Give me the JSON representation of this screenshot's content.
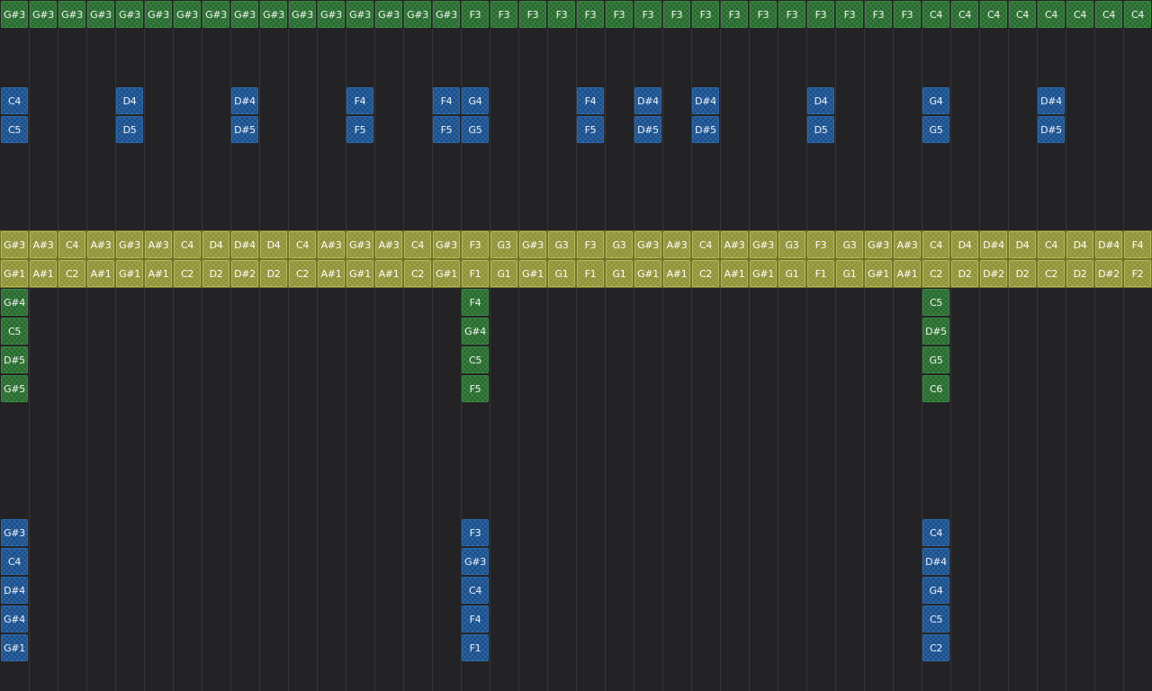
{
  "colors": {
    "background": "#232325",
    "column_line": "#37373b",
    "green_note": "#256b2c",
    "blue_note": "#174f8e",
    "yellow_note": "#8f9233",
    "yellow_band": "#72742a"
  },
  "columns": 40,
  "rows": [
    {
      "kind": "green",
      "row": 0,
      "notes": [
        "G#3",
        "G#3",
        "G#3",
        "G#3",
        "G#3",
        "G#3",
        "G#3",
        "G#3",
        "G#3",
        "G#3",
        "G#3",
        "G#3",
        "G#3",
        "G#3",
        "G#3",
        "G#3",
        "F3",
        "F3",
        "F3",
        "F3",
        "F3",
        "F3",
        "F3",
        "F3",
        "F3",
        "F3",
        "F3",
        "F3",
        "F3",
        "F3",
        "F3",
        "F3",
        "C4",
        "C4",
        "C4",
        "C4",
        "C4",
        "C4",
        "C4",
        "C4"
      ]
    },
    {
      "kind": "blue",
      "row": 3,
      "notes": [
        "C4",
        "",
        "",
        "",
        "D4",
        "",
        "",
        "",
        "D#4",
        "",
        "",
        "",
        "F4",
        "",
        "",
        "F4",
        "G4",
        "",
        "",
        "",
        "F4",
        "",
        "D#4",
        "",
        "D#4",
        "",
        "",
        "",
        "D4",
        "",
        "",
        "",
        "G4",
        "",
        "",
        "",
        "D#4",
        "",
        "",
        ""
      ]
    },
    {
      "kind": "blue",
      "row": 4,
      "notes": [
        "C5",
        "",
        "",
        "",
        "D5",
        "",
        "",
        "",
        "D#5",
        "",
        "",
        "",
        "F5",
        "",
        "",
        "F5",
        "G5",
        "",
        "",
        "",
        "F5",
        "",
        "D#5",
        "",
        "D#5",
        "",
        "",
        "",
        "D5",
        "",
        "",
        "",
        "G5",
        "",
        "",
        "",
        "D#5",
        "",
        "",
        ""
      ]
    },
    {
      "kind": "yellow",
      "row": 8,
      "notes": [
        "G#3",
        "A#3",
        "C4",
        "A#3",
        "G#3",
        "A#3",
        "C4",
        "D4",
        "D#4",
        "D4",
        "C4",
        "A#3",
        "G#3",
        "A#3",
        "C4",
        "G#3",
        "F3",
        "G3",
        "G#3",
        "G3",
        "F3",
        "G3",
        "G#3",
        "A#3",
        "C4",
        "A#3",
        "G#3",
        "G3",
        "F3",
        "G3",
        "G#3",
        "A#3",
        "C4",
        "D4",
        "D#4",
        "D4",
        "C4",
        "D4",
        "D#4",
        "F4"
      ]
    },
    {
      "kind": "yellow",
      "row": 9,
      "notes": [
        "G#1",
        "A#1",
        "C2",
        "A#1",
        "G#1",
        "A#1",
        "C2",
        "D2",
        "D#2",
        "D2",
        "C2",
        "A#1",
        "G#1",
        "A#1",
        "C2",
        "G#1",
        "F1",
        "G1",
        "G#1",
        "G1",
        "F1",
        "G1",
        "G#1",
        "A#1",
        "C2",
        "A#1",
        "G#1",
        "G1",
        "F1",
        "G1",
        "G#1",
        "A#1",
        "C2",
        "D2",
        "D#2",
        "D2",
        "C2",
        "D2",
        "D#2",
        "F2"
      ]
    },
    {
      "kind": "green",
      "row": 10,
      "notes": [
        "G#4",
        "",
        "",
        "",
        "",
        "",
        "",
        "",
        "",
        "",
        "",
        "",
        "",
        "",
        "",
        "",
        "F4",
        "",
        "",
        "",
        "",
        "",
        "",
        "",
        "",
        "",
        "",
        "",
        "",
        "",
        "",
        "",
        "C5",
        "",
        "",
        "",
        "",
        "",
        "",
        ""
      ]
    },
    {
      "kind": "green",
      "row": 11,
      "notes": [
        "C5",
        "",
        "",
        "",
        "",
        "",
        "",
        "",
        "",
        "",
        "",
        "",
        "",
        "",
        "",
        "",
        "G#4",
        "",
        "",
        "",
        "",
        "",
        "",
        "",
        "",
        "",
        "",
        "",
        "",
        "",
        "",
        "",
        "D#5",
        "",
        "",
        "",
        "",
        "",
        "",
        ""
      ]
    },
    {
      "kind": "green",
      "row": 12,
      "notes": [
        "D#5",
        "",
        "",
        "",
        "",
        "",
        "",
        "",
        "",
        "",
        "",
        "",
        "",
        "",
        "",
        "",
        "C5",
        "",
        "",
        "",
        "",
        "",
        "",
        "",
        "",
        "",
        "",
        "",
        "",
        "",
        "",
        "",
        "G5",
        "",
        "",
        "",
        "",
        "",
        "",
        ""
      ]
    },
    {
      "kind": "green",
      "row": 13,
      "notes": [
        "G#5",
        "",
        "",
        "",
        "",
        "",
        "",
        "",
        "",
        "",
        "",
        "",
        "",
        "",
        "",
        "",
        "F5",
        "",
        "",
        "",
        "",
        "",
        "",
        "",
        "",
        "",
        "",
        "",
        "",
        "",
        "",
        "",
        "C6",
        "",
        "",
        "",
        "",
        "",
        "",
        ""
      ]
    },
    {
      "kind": "blue",
      "row": 18,
      "notes": [
        "G#3",
        "",
        "",
        "",
        "",
        "",
        "",
        "",
        "",
        "",
        "",
        "",
        "",
        "",
        "",
        "",
        "F3",
        "",
        "",
        "",
        "",
        "",
        "",
        "",
        "",
        "",
        "",
        "",
        "",
        "",
        "",
        "",
        "C4",
        "",
        "",
        "",
        "",
        "",
        "",
        ""
      ]
    },
    {
      "kind": "blue",
      "row": 19,
      "notes": [
        "C4",
        "",
        "",
        "",
        "",
        "",
        "",
        "",
        "",
        "",
        "",
        "",
        "",
        "",
        "",
        "",
        "G#3",
        "",
        "",
        "",
        "",
        "",
        "",
        "",
        "",
        "",
        "",
        "",
        "",
        "",
        "",
        "",
        "D#4",
        "",
        "",
        "",
        "",
        "",
        "",
        ""
      ]
    },
    {
      "kind": "blue",
      "row": 20,
      "notes": [
        "D#4",
        "",
        "",
        "",
        "",
        "",
        "",
        "",
        "",
        "",
        "",
        "",
        "",
        "",
        "",
        "",
        "C4",
        "",
        "",
        "",
        "",
        "",
        "",
        "",
        "",
        "",
        "",
        "",
        "",
        "",
        "",
        "",
        "G4",
        "",
        "",
        "",
        "",
        "",
        "",
        ""
      ]
    },
    {
      "kind": "blue",
      "row": 21,
      "notes": [
        "G#4",
        "",
        "",
        "",
        "",
        "",
        "",
        "",
        "",
        "",
        "",
        "",
        "",
        "",
        "",
        "",
        "F4",
        "",
        "",
        "",
        "",
        "",
        "",
        "",
        "",
        "",
        "",
        "",
        "",
        "",
        "",
        "",
        "C5",
        "",
        "",
        "",
        "",
        "",
        "",
        ""
      ]
    },
    {
      "kind": "blue",
      "row": 22,
      "notes": [
        "G#1",
        "",
        "",
        "",
        "",
        "",
        "",
        "",
        "",
        "",
        "",
        "",
        "",
        "",
        "",
        "",
        "F1",
        "",
        "",
        "",
        "",
        "",
        "",
        "",
        "",
        "",
        "",
        "",
        "",
        "",
        "",
        "",
        "C2",
        "",
        "",
        "",
        "",
        "",
        "",
        ""
      ]
    }
  ]
}
